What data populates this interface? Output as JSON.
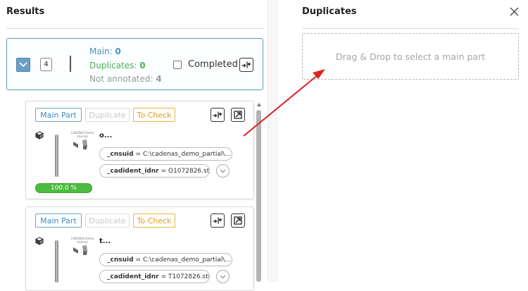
{
  "results": {
    "title": "Results",
    "summary": {
      "count": "4",
      "main_label": "Main:",
      "main_value": "0",
      "duplicates_label": "Duplicates:",
      "duplicates_value": "0",
      "not_annotated_label": "Not annotated:",
      "not_annotated_value": "4",
      "completed_label": "Completed"
    },
    "cards": [
      {
        "tag_main": "Main Part",
        "tag_duplicate": "Duplicate",
        "tag_check": "To Check",
        "thumb_label": "CADENAS Demo internal",
        "name": "o...",
        "attr1_key": "_cnsuid",
        "attr1_value": "= C:\\cadenas_demo_partial\\...",
        "attr2_key": "_cadident_idnr",
        "attr2_value": "= O1072826.stl",
        "score": "100.0 %",
        "score_value": 1.0
      },
      {
        "tag_main": "Main Part",
        "tag_duplicate": "Duplicate",
        "tag_check": "To Check",
        "thumb_label": "CADENAS Demo internal",
        "name": "t...",
        "attr1_key": "_cnsuid",
        "attr1_value": "= C:\\cadenas_demo_partial\\...",
        "attr2_key": "_cadident_idnr",
        "attr2_value": "= T1072826.stl"
      }
    ]
  },
  "duplicates": {
    "title": "Duplicates",
    "dropzone_text": "Drag & Drop to select a main part"
  },
  "colors": {
    "accent_blue": "#4a90c0",
    "duplicate_green": "#4caf50",
    "to_check_orange": "#e39b1c",
    "annotation_arrow": "#e02020"
  },
  "icons": {
    "collapse": "chevron-down-icon",
    "merge": "merge-arrows-icon",
    "open_external": "open-external-icon",
    "cube": "cube-icon",
    "expand": "chevron-down-icon",
    "close": "close-icon"
  }
}
